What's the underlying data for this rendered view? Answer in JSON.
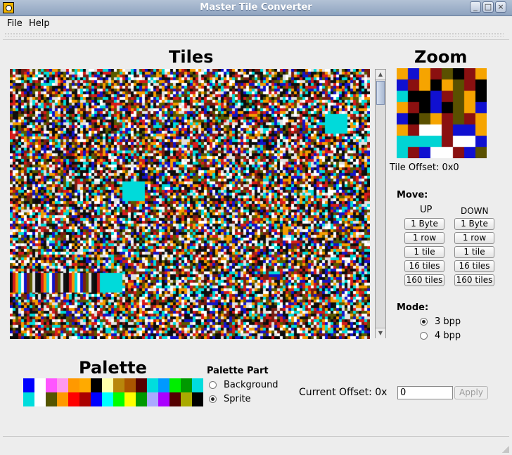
{
  "window": {
    "title": "Master Tile Converter",
    "minimize_glyph": "_",
    "maximize_glyph": "□",
    "close_glyph": "×"
  },
  "menu": {
    "file": "File",
    "help": "Help"
  },
  "tiles": {
    "heading": "Tiles"
  },
  "zoom": {
    "heading": "Zoom",
    "tile_offset": "Tile Offset: 0x0"
  },
  "move": {
    "label": "Move:",
    "up_label": "UP",
    "down_label": "DOWN",
    "steps": [
      "1 Byte",
      "1 row",
      "1 tile",
      "16 tiles",
      "160 tiles"
    ]
  },
  "mode": {
    "label": "Mode:",
    "options": [
      "3 bpp",
      "4 bpp"
    ],
    "selected": "3 bpp"
  },
  "palette": {
    "heading": "Palette",
    "colors": [
      "#0000ff",
      "#ffffff",
      "#ff55ff",
      "#ff99ee",
      "#ff9900",
      "#ffaa00",
      "#000000",
      "#ffffaa",
      "#b8860b",
      "#aa5500",
      "#550000",
      "#00dddd",
      "#0099ff",
      "#00ee00",
      "#009900",
      "#00dddd",
      "#00dddd",
      "#ffffff",
      "#555500",
      "#ff9900",
      "#ff0000",
      "#aa0000",
      "#0000ff",
      "#00ffff",
      "#00ff00",
      "#ffff00",
      "#009900",
      "#aaaaff",
      "#aa00ff",
      "#550000",
      "#aaaa00",
      "#000000"
    ]
  },
  "palette_part": {
    "label": "Palette Part",
    "options": [
      "Background",
      "Sprite"
    ],
    "selected": "Sprite"
  },
  "offset": {
    "label": "Current Offset: 0x",
    "value": "0",
    "apply": "Apply"
  },
  "tile_colors": [
    "#0c0c0c",
    "#d71c1c",
    "#f49b00",
    "#00dada",
    "#ffffff",
    "#1414c8",
    "#7a1e12",
    "#5a5a00",
    "#e0e0e0",
    "#111111"
  ],
  "zoom_cells": [
    "#f6a400",
    "#1010d0",
    "#f6a400",
    "#8a1010",
    "#5a5000",
    "#000000",
    "#8a1010",
    "#f6a400",
    "#1010d0",
    "#8a1010",
    "#f6a400",
    "#000000",
    "#f6a400",
    "#5a5000",
    "#8a1010",
    "#000000",
    "#00d4d4",
    "#000000",
    "#000000",
    "#1010d0",
    "#8a1010",
    "#5a5000",
    "#f6a400",
    "#000000",
    "#f6a400",
    "#8a1010",
    "#000000",
    "#1010d0",
    "#000000",
    "#5a5000",
    "#f6a400",
    "#1010d0",
    "#1010d0",
    "#000000",
    "#5a5000",
    "#f6a400",
    "#8a1010",
    "#5a5000",
    "#8a1010",
    "#f6a400",
    "#f6a400",
    "#8a1010",
    "#ffffff",
    "#ffffff",
    "#8a1010",
    "#1010d0",
    "#1010d0",
    "#f6a400",
    "#00d4d4",
    "#00d4d4",
    "#00d4d4",
    "#00d4d4",
    "#8a1010",
    "#ffffff",
    "#ffffff",
    "#1010d0",
    "#00d4d4",
    "#8a1010",
    "#1010d0",
    "#ffffff",
    "#ffffff",
    "#8a1010",
    "#1010d0",
    "#5a5000"
  ]
}
